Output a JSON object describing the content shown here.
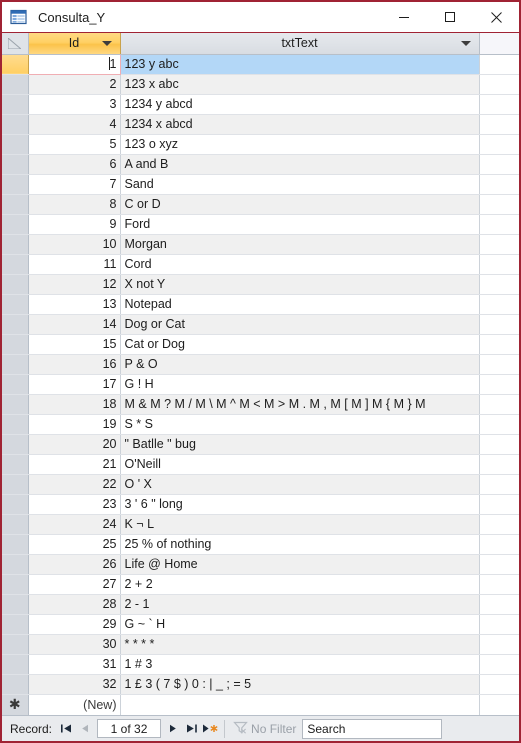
{
  "window": {
    "title": "Consulta_Y",
    "icon": "datasheet-query-icon",
    "minimize_label": "—",
    "maximize_label": "□",
    "close_label": "×",
    "border_color": "#a02334"
  },
  "datasheet": {
    "select_all_tooltip": "Select All",
    "columns": [
      {
        "key": "id",
        "label": "Id",
        "sorted_highlight": true,
        "accent": "#ffd064"
      },
      {
        "key": "txtText",
        "label": "txtText",
        "sorted_highlight": false,
        "accent": "#dfe3e8"
      }
    ],
    "selected_row_index": 0,
    "selection_color": "#b3d7f7",
    "active_cell_border_color": "#f0aeb3",
    "new_row_label": "(New)",
    "new_row_marker": "✱",
    "rows": [
      {
        "id": "1",
        "txtText": "123 y abc"
      },
      {
        "id": "2",
        "txtText": "123 x abc"
      },
      {
        "id": "3",
        "txtText": "1234 y abcd"
      },
      {
        "id": "4",
        "txtText": "1234 x abcd"
      },
      {
        "id": "5",
        "txtText": "123 o xyz"
      },
      {
        "id": "6",
        "txtText": "A and B"
      },
      {
        "id": "7",
        "txtText": "Sand"
      },
      {
        "id": "8",
        "txtText": "C or D"
      },
      {
        "id": "9",
        "txtText": "Ford"
      },
      {
        "id": "10",
        "txtText": "Morgan"
      },
      {
        "id": "11",
        "txtText": "Cord"
      },
      {
        "id": "12",
        "txtText": "X not Y"
      },
      {
        "id": "13",
        "txtText": "Notepad"
      },
      {
        "id": "14",
        "txtText": "Dog or Cat"
      },
      {
        "id": "15",
        "txtText": "Cat or Dog"
      },
      {
        "id": "16",
        "txtText": "P & O"
      },
      {
        "id": "17",
        "txtText": "G ! H"
      },
      {
        "id": "18",
        "txtText": "M & M ? M / M \\ M ^ M < M > M . M , M [ M ] M { M } M"
      },
      {
        "id": "19",
        "txtText": "S * S"
      },
      {
        "id": "20",
        "txtText": "\" Batlle \" bug"
      },
      {
        "id": "21",
        "txtText": "O'Neill"
      },
      {
        "id": "22",
        "txtText": "O ' X"
      },
      {
        "id": "23",
        "txtText": "3 ' 6 \" long"
      },
      {
        "id": "24",
        "txtText": "K ¬ L"
      },
      {
        "id": "25",
        "txtText": "25 % of nothing"
      },
      {
        "id": "26",
        "txtText": "Life @ Home"
      },
      {
        "id": "27",
        "txtText": "2 + 2"
      },
      {
        "id": "28",
        "txtText": "2 - 1"
      },
      {
        "id": "29",
        "txtText": "G ~ ` H"
      },
      {
        "id": "30",
        "txtText": "* * * *"
      },
      {
        "id": "31",
        "txtText": "1 # 3"
      },
      {
        "id": "32",
        "txtText": "1 £ 3 ( 7 $ ) 0 : | _ ; = 5"
      }
    ]
  },
  "navbar": {
    "record_label": "Record:",
    "first_icon": "go-first-icon",
    "previous_icon": "go-previous-icon",
    "next_icon": "go-next-icon",
    "last_icon": "go-last-icon",
    "new_icon": "new-record-icon",
    "position": "1 of 32",
    "filter_icon": "filter-icon",
    "filter_label": "No Filter",
    "search_value": "Search",
    "search_placeholder": "Search"
  }
}
